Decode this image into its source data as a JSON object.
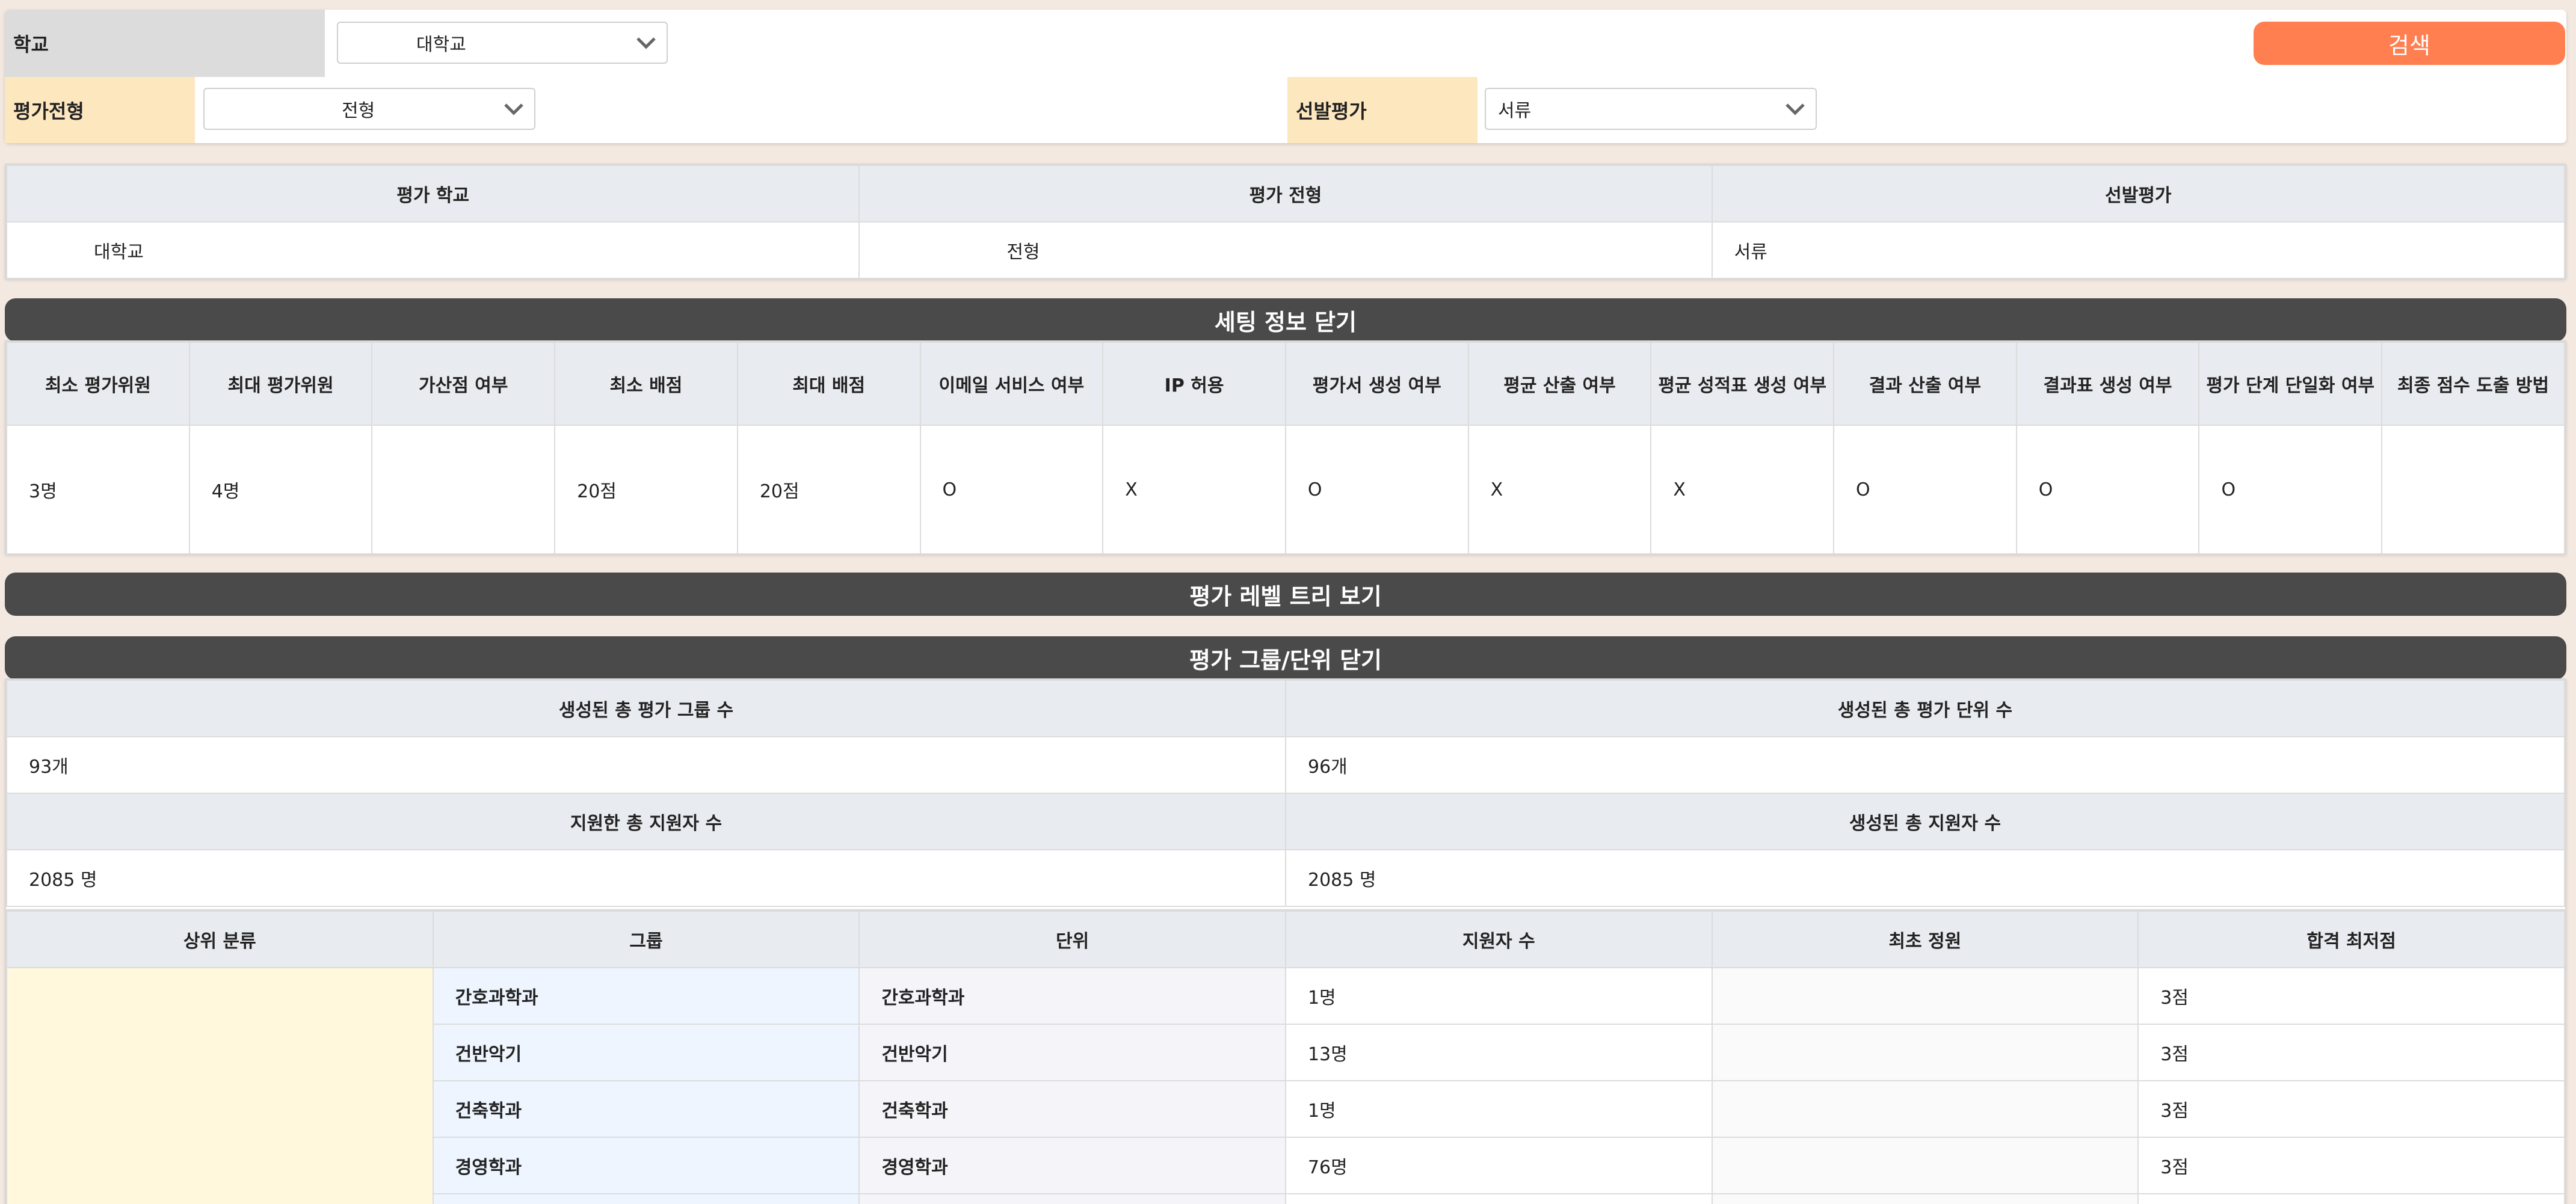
{
  "filter": {
    "school_label": "학교",
    "school_value": "대학교",
    "type_label": "평가전형",
    "type_value": "전형",
    "selection_label": "선발평가",
    "selection_value": "서류",
    "search_button": "검색"
  },
  "summary": {
    "headers": [
      "평가 학교",
      "평가 전형",
      "선발평가"
    ],
    "values": [
      "대학교",
      "전형",
      "서류"
    ]
  },
  "settings": {
    "bar_label": "세팅 정보 닫기",
    "headers": [
      "최소 평가위원",
      "최대 평가위원",
      "가산점 여부",
      "최소 배점",
      "최대 배점",
      "이메일 서비스 여부",
      "IP 허용",
      "평가서 생성 여부",
      "평균 산출 여부",
      "평균 성적표 생성 여부",
      "결과 산출 여부",
      "결과표 생성 여부",
      "평가 단계 단일화 여부",
      "최종 점수 도출 방법"
    ],
    "values": [
      "3명",
      "4명",
      "",
      "20점",
      "20점",
      "O",
      "X",
      "O",
      "X",
      "X",
      "O",
      "O",
      "O",
      ""
    ]
  },
  "tree_bar_label": "평가 레벨 트리 보기",
  "groups": {
    "bar_label": "평가 그룹/단위 닫기",
    "total_groups_label": "생성된 총 평가 그룹 수",
    "total_groups_value": "93개",
    "total_units_label": "생성된 총 평가 단위 수",
    "total_units_value": "96개",
    "applied_label": "지원한 총 지원자 수",
    "applied_value": "2085 명",
    "created_label": "생성된 총 지원자 수",
    "created_value": "2085 명"
  },
  "detail": {
    "headers": [
      "상위 분류",
      "그룹",
      "단위",
      "지원자 수",
      "최초 정원",
      "합격 최저점"
    ],
    "rows": [
      {
        "group": "간호과학과",
        "unit": "간호과학과",
        "applicants": "1명",
        "quota": "",
        "min_score": "3점"
      },
      {
        "group": "건반악기",
        "unit": "건반악기",
        "applicants": "13명",
        "quota": "",
        "min_score": "3점"
      },
      {
        "group": "건축학과",
        "unit": "건축학과",
        "applicants": "1명",
        "quota": "",
        "min_score": "3점"
      },
      {
        "group": "경영학과",
        "unit": "경영학과",
        "applicants": "76명",
        "quota": "",
        "min_score": "3점"
      }
    ]
  }
}
